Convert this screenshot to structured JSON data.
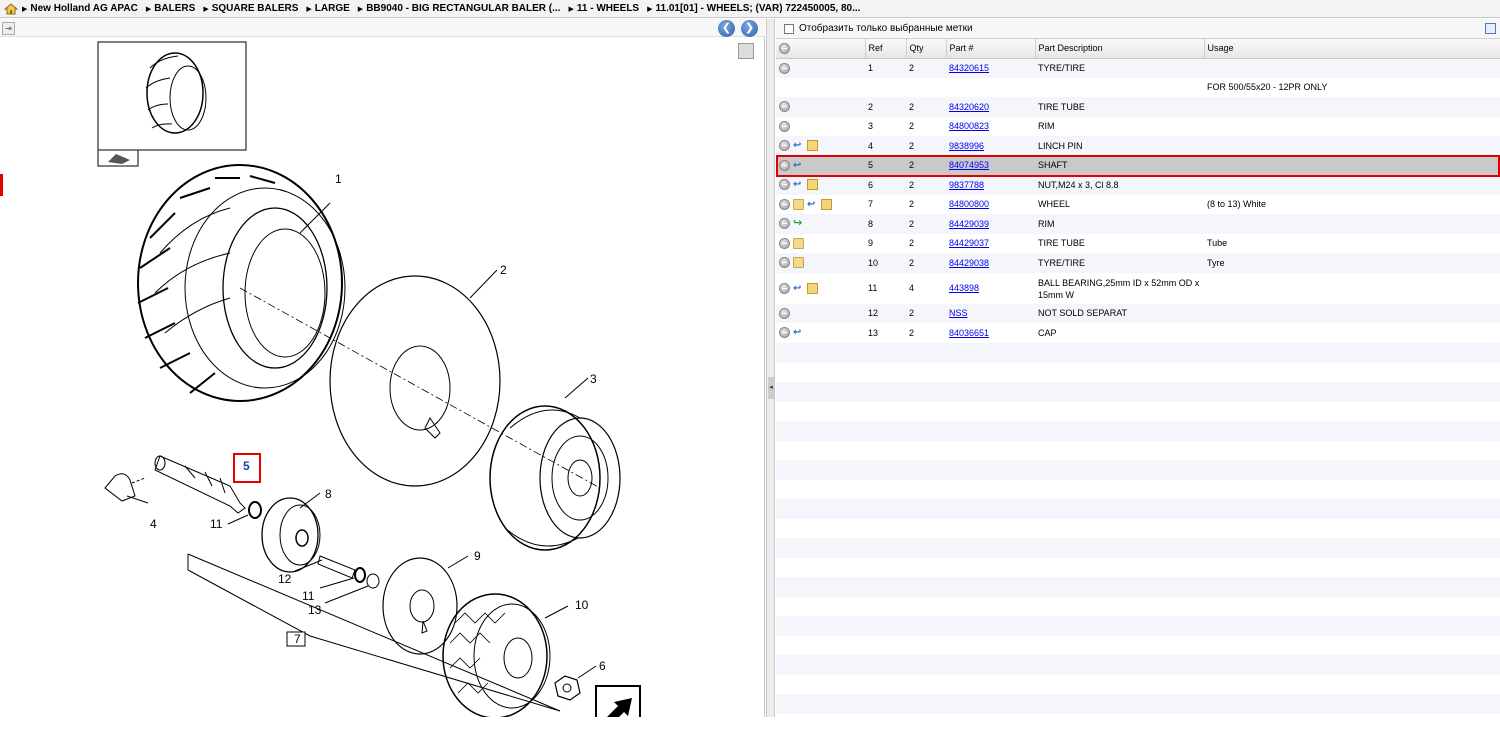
{
  "breadcrumb": {
    "items": [
      "New Holland AG APAC",
      "BALERS",
      "SQUARE BALERS",
      "LARGE",
      "BB9040 - BIG RECTANGULAR BALER (...",
      "11 - WHEELS",
      "11.01[01] - WHEELS; (VAR) 722450005, 80..."
    ]
  },
  "diagram": {
    "callouts": [
      "1",
      "2",
      "3",
      "4",
      "5",
      "6",
      "7",
      "8",
      "9",
      "10",
      "11",
      "11",
      "12",
      "13"
    ],
    "highlighted_callout": "5"
  },
  "filter": {
    "label": "Отобразить только выбранные метки",
    "checked": false
  },
  "table": {
    "columns": [
      "",
      "Ref",
      "Qty",
      "Part #",
      "Part Description",
      "Usage"
    ],
    "rows": [
      {
        "icons": [
          "plus"
        ],
        "ref": "1",
        "qty": "2",
        "part": "84320615",
        "desc": "TYRE/TIRE",
        "usage": ""
      },
      {
        "icons": [],
        "ref": "",
        "qty": "",
        "part": "",
        "desc": "",
        "usage": "FOR 500/55x20 - 12PR ONLY"
      },
      {
        "icons": [
          "plus"
        ],
        "ref": "2",
        "qty": "2",
        "part": "84320620",
        "desc": "TIRE TUBE",
        "usage": ""
      },
      {
        "icons": [
          "plus"
        ],
        "ref": "3",
        "qty": "2",
        "part": "84800823",
        "desc": "RIM",
        "usage": ""
      },
      {
        "icons": [
          "plus",
          "arrow",
          "box"
        ],
        "ref": "4",
        "qty": "2",
        "part": "9838996",
        "desc": "LINCH PIN",
        "usage": ""
      },
      {
        "icons": [
          "plus",
          "arrow"
        ],
        "ref": "5",
        "qty": "2",
        "part": "84074953",
        "desc": "SHAFT",
        "usage": "",
        "selected": true
      },
      {
        "icons": [
          "plus",
          "arrow",
          "box"
        ],
        "ref": "6",
        "qty": "2",
        "part": "9837788",
        "desc": "NUT,M24 x 3, Cl 8.8",
        "usage": ""
      },
      {
        "icons": [
          "plus",
          "folder",
          "arrow",
          "box"
        ],
        "ref": "7",
        "qty": "2",
        "part": "84800800",
        "desc": "WHEEL",
        "usage": "(8 to 13) White"
      },
      {
        "icons": [
          "plus",
          "green"
        ],
        "ref": "8",
        "qty": "2",
        "part": "84429039",
        "desc": "RIM",
        "usage": ""
      },
      {
        "icons": [
          "plus",
          "folder"
        ],
        "ref": "9",
        "qty": "2",
        "part": "84429037",
        "desc": "TIRE TUBE",
        "usage": "Tube"
      },
      {
        "icons": [
          "plus",
          "folder"
        ],
        "ref": "10",
        "qty": "2",
        "part": "84429038",
        "desc": "TYRE/TIRE",
        "usage": "Tyre"
      },
      {
        "icons": [
          "plus",
          "arrow",
          "box"
        ],
        "ref": "11",
        "qty": "4",
        "part": "443898",
        "desc": "BALL BEARING,25mm ID x 52mm OD x 15mm W",
        "usage": "",
        "tall": true
      },
      {
        "icons": [
          "plus"
        ],
        "ref": "12",
        "qty": "2",
        "part": "NSS",
        "desc": "NOT SOLD SEPARAT",
        "usage": ""
      },
      {
        "icons": [
          "plus",
          "arrow"
        ],
        "ref": "13",
        "qty": "2",
        "part": "84036651",
        "desc": "CAP",
        "usage": ""
      }
    ]
  },
  "colors": {
    "selection_outline": "#e00000",
    "link": "#0000ee",
    "selected_row": "#c9c9c9"
  }
}
